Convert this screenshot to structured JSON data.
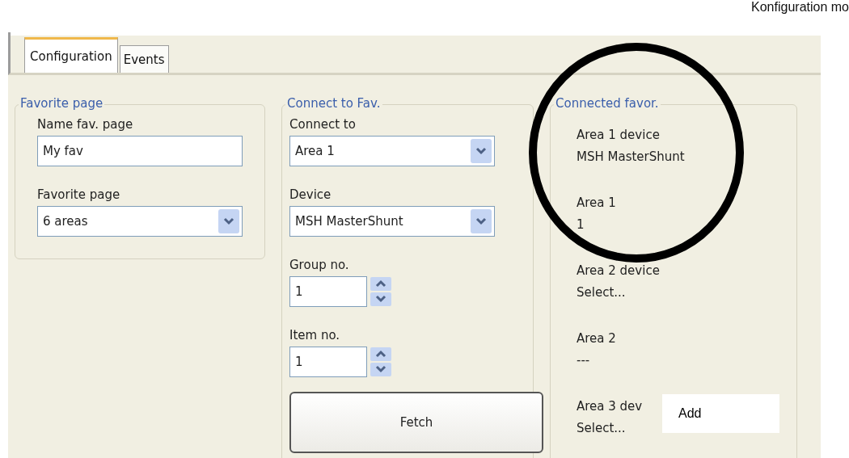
{
  "header_text": "Konfiguration mo",
  "tabs": [
    {
      "label": "Configuration",
      "selected": true
    },
    {
      "label": "Events",
      "selected": false
    }
  ],
  "groups": [
    {
      "title": "Favorite page",
      "fields": [
        {
          "kind": "text",
          "label": "Name fav. page",
          "value": "My fav"
        },
        {
          "kind": "dropdown",
          "label": "Favorite page",
          "value": "6 areas"
        }
      ]
    },
    {
      "title": "Connect to Fav.",
      "fields": [
        {
          "kind": "dropdown",
          "label": "Connect to",
          "value": "Area 1"
        },
        {
          "kind": "dropdown",
          "label": "Device",
          "value": "MSH MasterShunt"
        },
        {
          "kind": "spin",
          "label": "Group no.",
          "value": "1"
        },
        {
          "kind": "spin",
          "label": "Item no.",
          "value": "1"
        }
      ],
      "button": "Fetch"
    }
  ],
  "connected": {
    "title": "Connected favor.",
    "entries": [
      {
        "label": "Area 1 device",
        "value": "MSH MasterShunt"
      },
      {
        "label": "Area 1",
        "value": "1"
      },
      {
        "label": "Area 2 device",
        "value": "Select..."
      },
      {
        "label": "Area 2",
        "value": "---"
      },
      {
        "label": "Area 3 dev",
        "value": "Select..."
      }
    ]
  },
  "overlay_button": {
    "label": "Add"
  },
  "highlight": {
    "kind": "circle"
  }
}
